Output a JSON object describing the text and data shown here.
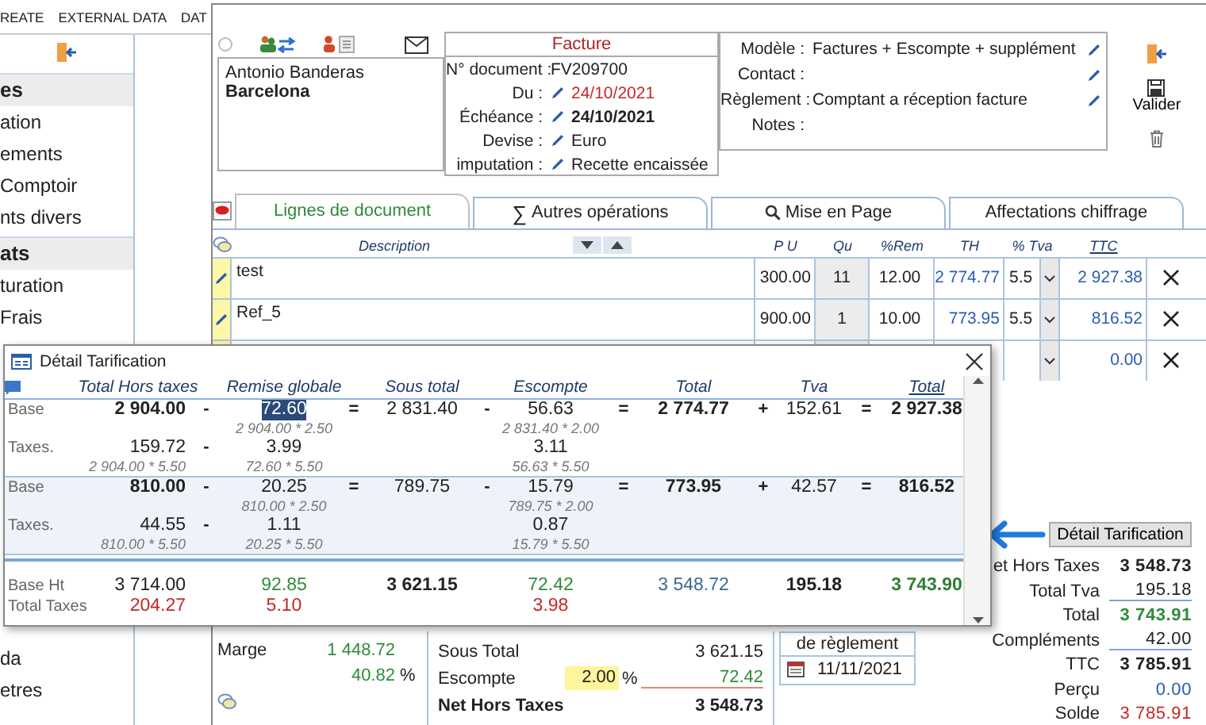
{
  "ribbon": {
    "tabs": [
      "REATE",
      "EXTERNAL DATA",
      "DAT"
    ]
  },
  "sidebar": {
    "sections": [
      {
        "title": "es",
        "items": [
          "ation",
          "ements",
          "Comptoir",
          "nts divers"
        ]
      },
      {
        "title": "ats",
        "items": [
          "turation",
          "Frais"
        ]
      }
    ],
    "bottom_items": [
      "da",
      "etres"
    ]
  },
  "form": {
    "customer": {
      "name": "Antonio Banderas",
      "city": "Barcelona"
    },
    "document": {
      "type": "Facture",
      "fields": [
        {
          "label": "N° document :",
          "value": "FV209700",
          "editable": false,
          "kind": "plain"
        },
        {
          "label": "Du :",
          "value": "24/10/2021",
          "editable": true,
          "kind": "alert"
        },
        {
          "label": "Échéance :",
          "value": "24/10/2021",
          "editable": true,
          "kind": "strong"
        },
        {
          "label": "Devise :",
          "value": "Euro",
          "editable": true,
          "kind": "plain"
        },
        {
          "label": "imputation :",
          "value": "Recette encaissée",
          "editable": true,
          "kind": "plain"
        }
      ]
    },
    "settings": [
      {
        "label": "Modèle :",
        "value": "Factures + Escompte + supplément",
        "editable": true
      },
      {
        "label": "Contact :",
        "editable": true
      },
      {
        "label": "Règlement :",
        "value": "Comptant a réception facture",
        "editable": true
      },
      {
        "label": "Notes :",
        "editable": false
      }
    ],
    "validate": "Valider"
  },
  "tabs": [
    {
      "label": "Lignes de document",
      "selected": true
    },
    {
      "label": "Autres opérations",
      "symbol": "∑",
      "selected": false
    },
    {
      "label": "Mise en Page",
      "kind": "search",
      "selected": false
    },
    {
      "label": "Affectations chiffrage",
      "selected": false
    }
  ],
  "lines": {
    "columns": {
      "description": "Description",
      "pu": "P U",
      "qty": "Qu",
      "discount": "%Rem",
      "th": "TH",
      "vat": "% Tva",
      "ttc": "TTC"
    },
    "rows": [
      {
        "description": "test",
        "pu": "300.00",
        "qty": "11",
        "discount": "12.00",
        "th": "2 774.77",
        "vat": "5.5",
        "ttc": "2 927.38"
      },
      {
        "description": "Ref_5",
        "pu": "900.00",
        "qty": "1",
        "discount": "10.00",
        "th": "773.95",
        "vat": "5.5",
        "ttc": "816.52"
      },
      {
        "ttc": "0.00"
      }
    ]
  },
  "summary": {
    "margin": {
      "label": "Marge",
      "amount": "1 448.72",
      "percent": "40.82",
      "unit": "%"
    },
    "subtotal": {
      "label": "Sous Total",
      "value": "3 621.15"
    },
    "discount": {
      "label": "Escompte",
      "rate": "2.00",
      "unit": "%",
      "value": "72.42"
    },
    "net": {
      "label": "Net Hors Taxes",
      "value": "3 548.73"
    },
    "payment": {
      "title": "de règlement",
      "date": "11/11/2021"
    }
  },
  "totals": {
    "button": "Détail Tarification",
    "rows": [
      {
        "label": "et Hors Taxes",
        "value": "3 548.73",
        "kind": "strong"
      },
      {
        "label": "Total Tva",
        "value": "195.18",
        "kind": "subtotal"
      },
      {
        "label": "Total",
        "value": "3 743.91",
        "kind": "positive"
      },
      {
        "label": "Compléments",
        "value": "42.00",
        "kind": "subtotal"
      },
      {
        "label": "TTC",
        "value": "3 785.91",
        "kind": "strong"
      },
      {
        "label": "Perçu",
        "value": "0.00",
        "kind": "info"
      },
      {
        "label": "Solde",
        "value": "3 785.91",
        "kind": "alert"
      }
    ]
  },
  "popup": {
    "title": "Détail Tarification",
    "columns": [
      "Total Hors taxes",
      "Remise globale",
      "Sous total",
      "Escompte",
      "Total",
      "Tva",
      "Total"
    ],
    "groups": [
      {
        "selected": false,
        "rows": [
          {
            "kind": "base",
            "label": "Base",
            "cells": [
              {
                "text": "2 904.00"
              },
              {
                "text": "-"
              },
              {
                "text": "72.60",
                "note": "2 904.00 * 2.50",
                "highlighted": true
              },
              {
                "text": "="
              },
              {
                "text": "2 831.40"
              },
              {
                "text": "-"
              },
              {
                "text": "56.63",
                "note": "2 831.40 * 2.00"
              },
              {
                "text": "="
              },
              {
                "text": "2 774.77"
              },
              {
                "text": "+"
              },
              {
                "text": "152.61"
              },
              {
                "text": "="
              },
              {
                "text": "2 927.38"
              }
            ]
          },
          {
            "kind": "taxes",
            "label": "Taxes.",
            "cells": [
              {
                "text": "159.72",
                "note": "2 904.00 * 5.50"
              },
              {
                "text": "-"
              },
              {
                "text": "3.99",
                "note": "72.60 * 5.50"
              },
              null,
              null,
              null,
              {
                "text": "3.11",
                "note": "56.63 * 5.50"
              },
              null,
              null,
              null,
              null,
              null,
              null
            ]
          }
        ]
      },
      {
        "selected": true,
        "rows": [
          {
            "kind": "base",
            "label": "Base",
            "cells": [
              {
                "text": "810.00"
              },
              {
                "text": "-"
              },
              {
                "text": "20.25",
                "note": "810.00 * 2.50"
              },
              {
                "text": "="
              },
              {
                "text": "789.75"
              },
              {
                "text": "-"
              },
              {
                "text": "15.79",
                "note": "789.75 * 2.00"
              },
              {
                "text": "="
              },
              {
                "text": "773.95"
              },
              {
                "text": "+"
              },
              {
                "text": "42.57"
              },
              {
                "text": "="
              },
              {
                "text": "816.52"
              }
            ]
          },
          {
            "kind": "taxes",
            "label": "Taxes.",
            "cells": [
              {
                "text": "44.55",
                "note": "810.00 * 5.50"
              },
              {
                "text": "-"
              },
              {
                "text": "1.11",
                "note": "20.25 * 5.50"
              },
              null,
              null,
              null,
              {
                "text": "0.87",
                "note": "15.79 * 5.50"
              },
              null,
              null,
              null,
              null,
              null,
              null
            ]
          }
        ]
      }
    ],
    "totals": [
      {
        "kind": "total",
        "label": "Base Ht",
        "cells": [
          {
            "text": "3 714.00"
          },
          null,
          {
            "text": "92.85",
            "color": "#2e8b3a"
          },
          null,
          {
            "text": "3 621.15"
          },
          null,
          {
            "text": "72.42",
            "color": "#2e8b3a"
          },
          null,
          {
            "text": "3 548.72",
            "color": "#3b6a8f"
          },
          null,
          {
            "text": "195.18"
          },
          null,
          {
            "text": "3 743.90",
            "color": "#2e7d32"
          }
        ]
      },
      {
        "kind": "tax_total",
        "label": "Total Taxes",
        "cells": [
          {
            "text": "204.27",
            "color": "#c62828"
          },
          null,
          {
            "text": "5.10",
            "color": "#c62828"
          },
          null,
          null,
          null,
          {
            "text": "3.98",
            "color": "#c62828"
          },
          null,
          null,
          null,
          null,
          null,
          null
        ]
      }
    ]
  }
}
